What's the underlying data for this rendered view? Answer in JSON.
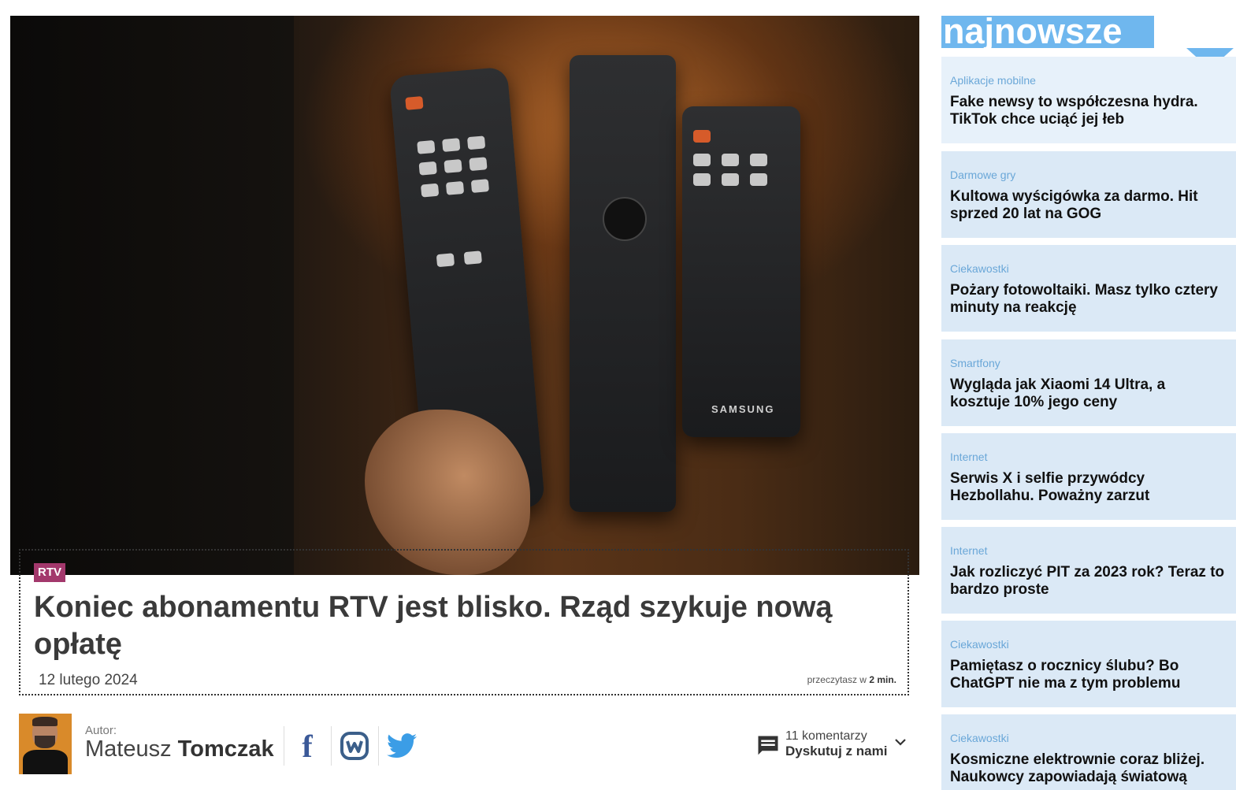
{
  "article": {
    "category": "RTV",
    "title": "Koniec abonamentu RTV jest blisko. Rząd szykuje nową opłatę",
    "date": "12 lutego 2024",
    "read_time_prefix": "przeczytasz w",
    "read_time_value": "2 min.",
    "image_brand_text": "SAMSUNG"
  },
  "author": {
    "label": "Autor:",
    "first_name": "Mateusz",
    "last_name": "Tomczak"
  },
  "social": {
    "facebook_icon": "facebook-icon",
    "wykop_icon": "wykop-icon",
    "twitter_icon": "twitter-icon"
  },
  "comments": {
    "count_text": "11 komentarzy",
    "cta": "Dyskutuj z nami"
  },
  "sidebar": {
    "title": "najnowsze",
    "items": [
      {
        "category": "Aplikacje mobilne",
        "title": "Fake newsy to współczesna hydra. TikTok chce uciąć jej łeb"
      },
      {
        "category": "Darmowe gry",
        "title": "Kultowa wyścigówka za darmo. Hit sprzed 20 lat na GOG"
      },
      {
        "category": "Ciekawostki",
        "title": "Pożary fotowoltaiki. Masz tylko cztery minuty na reakcję"
      },
      {
        "category": "Smartfony",
        "title": "Wygląda jak Xiaomi 14 Ultra, a kosztuje 10% jego ceny"
      },
      {
        "category": "Internet",
        "title": "Serwis X i selfie przywódcy Hezbollahu. Poważny zarzut"
      },
      {
        "category": "Internet",
        "title": "Jak rozliczyć PIT za 2023 rok? Teraz to bardzo proste"
      },
      {
        "category": "Ciekawostki",
        "title": "Pamiętasz o rocznicy ślubu? Bo ChatGPT nie ma z tym problemu"
      },
      {
        "category": "Ciekawostki",
        "title": "Kosmiczne elektrownie coraz bliżej. Naukowcy zapowiadają światową"
      }
    ]
  },
  "colors": {
    "category_badge": "#a3386c",
    "sidebar_accent": "#6fb7ee",
    "sidebar_card": "#dbe9f6"
  }
}
